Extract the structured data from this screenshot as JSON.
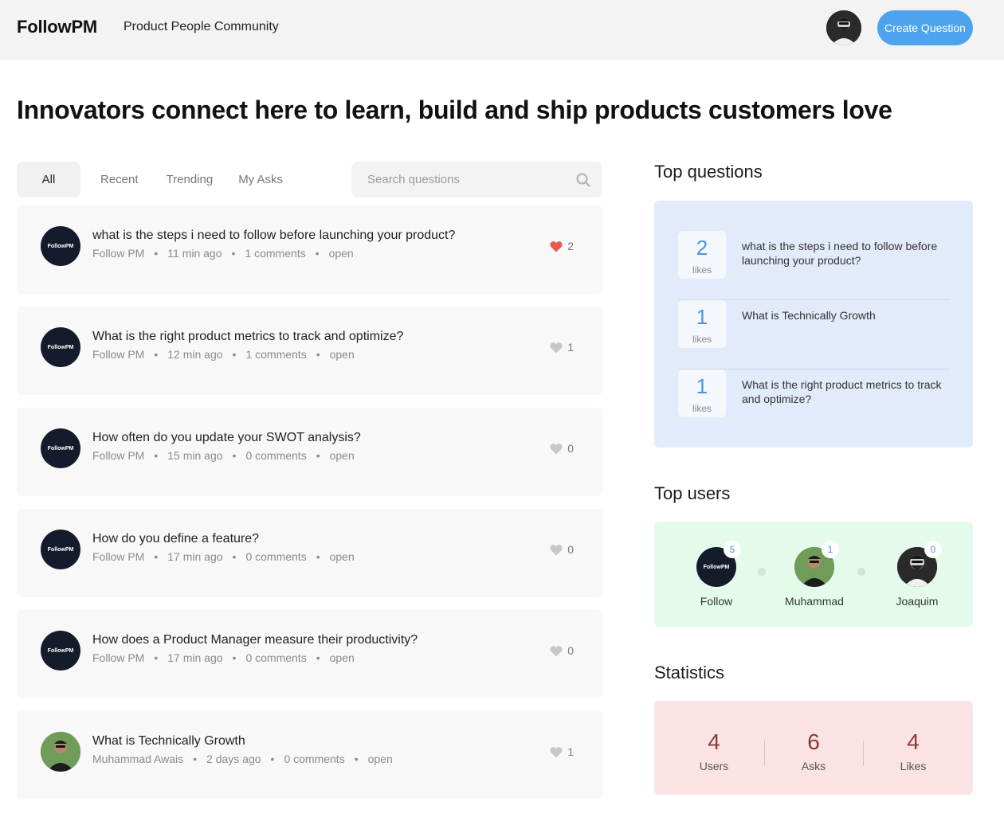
{
  "header": {
    "logo": "FollowPM",
    "tagline": "Product People Community",
    "create_button": "Create Question"
  },
  "hero": "Innovators connect here to learn, build and ship products customers love",
  "tabs": [
    {
      "label": "All",
      "active": true
    },
    {
      "label": "Recent",
      "active": false
    },
    {
      "label": "Trending",
      "active": false
    },
    {
      "label": "My Asks",
      "active": false
    }
  ],
  "search": {
    "placeholder": "Search questions"
  },
  "avatar_text": "FollowPM",
  "questions": [
    {
      "title": "what is the steps i need to follow before launching your product?",
      "author": "Follow PM",
      "time": "11 min ago",
      "comments": "1 comments",
      "status": "open",
      "likes": "2",
      "liked": true,
      "avatar": "logo"
    },
    {
      "title": "What is the right product metrics to track and optimize?",
      "author": "Follow PM",
      "time": "12 min ago",
      "comments": "1 comments",
      "status": "open",
      "likes": "1",
      "liked": false,
      "avatar": "logo"
    },
    {
      "title": "How often do you update your SWOT analysis?",
      "author": "Follow PM",
      "time": "15 min ago",
      "comments": "0 comments",
      "status": "open",
      "likes": "0",
      "liked": false,
      "avatar": "logo"
    },
    {
      "title": "How do you define a feature?",
      "author": "Follow PM",
      "time": "17 min ago",
      "comments": "0 comments",
      "status": "open",
      "likes": "0",
      "liked": false,
      "avatar": "logo"
    },
    {
      "title": "How does a Product Manager measure their productivity?",
      "author": "Follow PM",
      "time": "17 min ago",
      "comments": "0 comments",
      "status": "open",
      "likes": "0",
      "liked": false,
      "avatar": "logo"
    },
    {
      "title": "What is Technically Growth",
      "author": "Muhammad  Awais",
      "time": "2 days ago",
      "comments": "0 comments",
      "status": "open",
      "likes": "1",
      "liked": false,
      "avatar": "photo"
    }
  ],
  "top_questions": {
    "heading": "Top questions",
    "items": [
      {
        "count": "2",
        "label": "likes",
        "text": "what is the steps i need to follow before launching your product?"
      },
      {
        "count": "1",
        "label": "likes",
        "text": "What is Technically Growth"
      },
      {
        "count": "1",
        "label": "likes",
        "text": "What is the right product metrics to track and optimize?"
      }
    ]
  },
  "top_users": {
    "heading": "Top users",
    "items": [
      {
        "name": "Follow",
        "count": "5",
        "avatar": "logo"
      },
      {
        "name": "Muhammad",
        "count": "1",
        "avatar": "photo1"
      },
      {
        "name": "Joaquim",
        "count": "0",
        "avatar": "photo2"
      }
    ]
  },
  "statistics": {
    "heading": "Statistics",
    "items": [
      {
        "value": "4",
        "label": "Users"
      },
      {
        "value": "6",
        "label": "Asks"
      },
      {
        "value": "4",
        "label": "Likes"
      }
    ]
  },
  "colors": {
    "accent": "#4da3ee",
    "liked_heart": "#e85a4f",
    "heart": "#c7c7c7"
  }
}
